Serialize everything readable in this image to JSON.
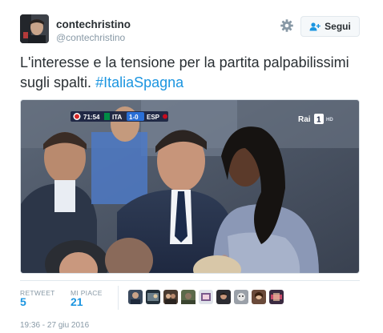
{
  "tweet": {
    "display_name": "contechristino",
    "screen_name": "@contechristino",
    "follow_label": "Segui",
    "text_plain": "L'interesse e la tensione per la partita palpabilissimi sugli spalti.",
    "hashtag": "#ItaliaSpagna",
    "timestamp": "19:36 - 27 giu 2016"
  },
  "media": {
    "score_time": "71:54",
    "team_home": "ITA",
    "score": "1-0",
    "team_away": "ESP",
    "channel": "Rai",
    "channel_number": "1",
    "channel_hd": "HD"
  },
  "stats": {
    "retweet_label": "RETWEET",
    "retweet_count": "5",
    "likes_label": "MI PIACE",
    "likes_count": "21"
  },
  "colors": {
    "link": "#1b95e0",
    "text": "#292f33",
    "muted": "#8899a6",
    "border": "#e1e8ed"
  },
  "icons": {
    "settings": "gear-icon",
    "follow": "add-user-icon"
  }
}
